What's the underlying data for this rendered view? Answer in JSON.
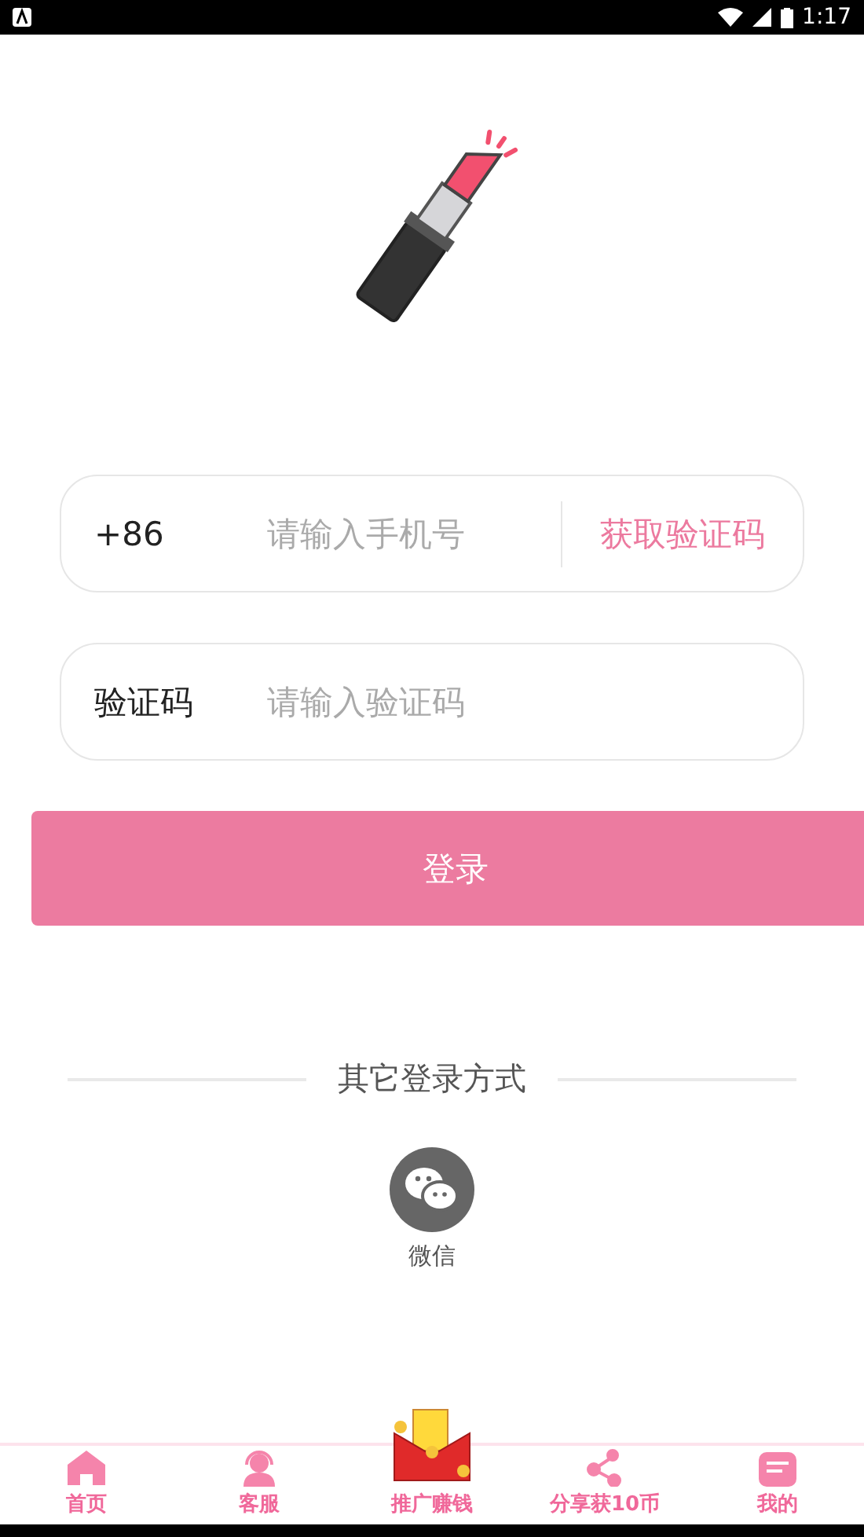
{
  "status_bar": {
    "time": "1:17"
  },
  "phone_field": {
    "prefix": "+86",
    "placeholder": "请输入手机号",
    "action": "获取验证码"
  },
  "code_field": {
    "label": "验证码",
    "placeholder": "请输入验证码"
  },
  "login_button": "登录",
  "other_login": {
    "title": "其它登录方式",
    "options": [
      {
        "label": "微信"
      }
    ]
  },
  "tab_bar": [
    {
      "label": "首页",
      "kind": "home"
    },
    {
      "label": "客服",
      "kind": "service"
    },
    {
      "label": "推广赚钱",
      "kind": "promo"
    },
    {
      "label": "分享获10币",
      "kind": "share"
    },
    {
      "label": "我的",
      "kind": "profile"
    }
  ]
}
